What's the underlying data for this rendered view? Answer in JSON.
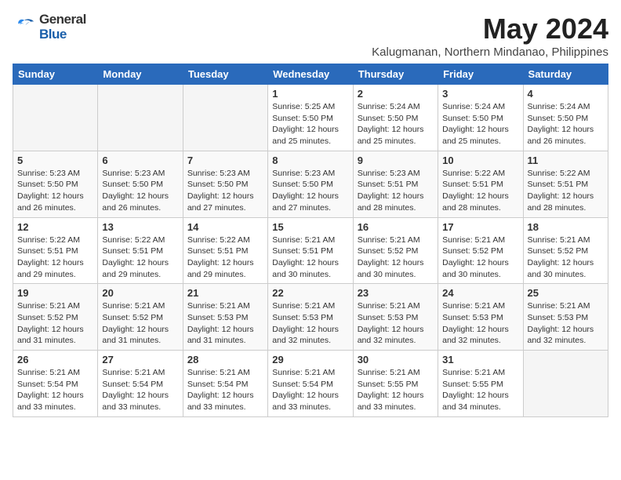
{
  "logo": {
    "general": "General",
    "blue": "Blue"
  },
  "title": {
    "month_year": "May 2024",
    "location": "Kalugmanan, Northern Mindanao, Philippines"
  },
  "headers": [
    "Sunday",
    "Monday",
    "Tuesday",
    "Wednesday",
    "Thursday",
    "Friday",
    "Saturday"
  ],
  "weeks": [
    [
      {
        "day": "",
        "info": ""
      },
      {
        "day": "",
        "info": ""
      },
      {
        "day": "",
        "info": ""
      },
      {
        "day": "1",
        "info": "Sunrise: 5:25 AM\nSunset: 5:50 PM\nDaylight: 12 hours\nand 25 minutes."
      },
      {
        "day": "2",
        "info": "Sunrise: 5:24 AM\nSunset: 5:50 PM\nDaylight: 12 hours\nand 25 minutes."
      },
      {
        "day": "3",
        "info": "Sunrise: 5:24 AM\nSunset: 5:50 PM\nDaylight: 12 hours\nand 25 minutes."
      },
      {
        "day": "4",
        "info": "Sunrise: 5:24 AM\nSunset: 5:50 PM\nDaylight: 12 hours\nand 26 minutes."
      }
    ],
    [
      {
        "day": "5",
        "info": "Sunrise: 5:23 AM\nSunset: 5:50 PM\nDaylight: 12 hours\nand 26 minutes."
      },
      {
        "day": "6",
        "info": "Sunrise: 5:23 AM\nSunset: 5:50 PM\nDaylight: 12 hours\nand 26 minutes."
      },
      {
        "day": "7",
        "info": "Sunrise: 5:23 AM\nSunset: 5:50 PM\nDaylight: 12 hours\nand 27 minutes."
      },
      {
        "day": "8",
        "info": "Sunrise: 5:23 AM\nSunset: 5:50 PM\nDaylight: 12 hours\nand 27 minutes."
      },
      {
        "day": "9",
        "info": "Sunrise: 5:23 AM\nSunset: 5:51 PM\nDaylight: 12 hours\nand 28 minutes."
      },
      {
        "day": "10",
        "info": "Sunrise: 5:22 AM\nSunset: 5:51 PM\nDaylight: 12 hours\nand 28 minutes."
      },
      {
        "day": "11",
        "info": "Sunrise: 5:22 AM\nSunset: 5:51 PM\nDaylight: 12 hours\nand 28 minutes."
      }
    ],
    [
      {
        "day": "12",
        "info": "Sunrise: 5:22 AM\nSunset: 5:51 PM\nDaylight: 12 hours\nand 29 minutes."
      },
      {
        "day": "13",
        "info": "Sunrise: 5:22 AM\nSunset: 5:51 PM\nDaylight: 12 hours\nand 29 minutes."
      },
      {
        "day": "14",
        "info": "Sunrise: 5:22 AM\nSunset: 5:51 PM\nDaylight: 12 hours\nand 29 minutes."
      },
      {
        "day": "15",
        "info": "Sunrise: 5:21 AM\nSunset: 5:51 PM\nDaylight: 12 hours\nand 30 minutes."
      },
      {
        "day": "16",
        "info": "Sunrise: 5:21 AM\nSunset: 5:52 PM\nDaylight: 12 hours\nand 30 minutes."
      },
      {
        "day": "17",
        "info": "Sunrise: 5:21 AM\nSunset: 5:52 PM\nDaylight: 12 hours\nand 30 minutes."
      },
      {
        "day": "18",
        "info": "Sunrise: 5:21 AM\nSunset: 5:52 PM\nDaylight: 12 hours\nand 30 minutes."
      }
    ],
    [
      {
        "day": "19",
        "info": "Sunrise: 5:21 AM\nSunset: 5:52 PM\nDaylight: 12 hours\nand 31 minutes."
      },
      {
        "day": "20",
        "info": "Sunrise: 5:21 AM\nSunset: 5:52 PM\nDaylight: 12 hours\nand 31 minutes."
      },
      {
        "day": "21",
        "info": "Sunrise: 5:21 AM\nSunset: 5:53 PM\nDaylight: 12 hours\nand 31 minutes."
      },
      {
        "day": "22",
        "info": "Sunrise: 5:21 AM\nSunset: 5:53 PM\nDaylight: 12 hours\nand 32 minutes."
      },
      {
        "day": "23",
        "info": "Sunrise: 5:21 AM\nSunset: 5:53 PM\nDaylight: 12 hours\nand 32 minutes."
      },
      {
        "day": "24",
        "info": "Sunrise: 5:21 AM\nSunset: 5:53 PM\nDaylight: 12 hours\nand 32 minutes."
      },
      {
        "day": "25",
        "info": "Sunrise: 5:21 AM\nSunset: 5:53 PM\nDaylight: 12 hours\nand 32 minutes."
      }
    ],
    [
      {
        "day": "26",
        "info": "Sunrise: 5:21 AM\nSunset: 5:54 PM\nDaylight: 12 hours\nand 33 minutes."
      },
      {
        "day": "27",
        "info": "Sunrise: 5:21 AM\nSunset: 5:54 PM\nDaylight: 12 hours\nand 33 minutes."
      },
      {
        "day": "28",
        "info": "Sunrise: 5:21 AM\nSunset: 5:54 PM\nDaylight: 12 hours\nand 33 minutes."
      },
      {
        "day": "29",
        "info": "Sunrise: 5:21 AM\nSunset: 5:54 PM\nDaylight: 12 hours\nand 33 minutes."
      },
      {
        "day": "30",
        "info": "Sunrise: 5:21 AM\nSunset: 5:55 PM\nDaylight: 12 hours\nand 33 minutes."
      },
      {
        "day": "31",
        "info": "Sunrise: 5:21 AM\nSunset: 5:55 PM\nDaylight: 12 hours\nand 34 minutes."
      },
      {
        "day": "",
        "info": ""
      }
    ]
  ]
}
